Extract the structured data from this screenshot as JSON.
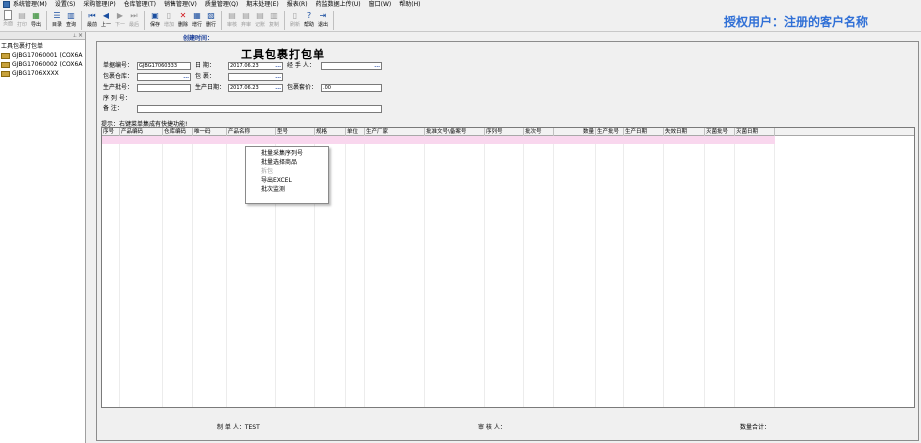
{
  "menu": {
    "items": [
      "系统管理(M)",
      "设置(S)",
      "采购管理(P)",
      "仓库管理(T)",
      "销售管理(V)",
      "质量管理(Q)",
      "期末处理(E)",
      "报表(R)",
      "药监数据上传(U)",
      "窗口(W)",
      "帮助(H)"
    ]
  },
  "toolbar": {
    "buttons": [
      {
        "label": "页面",
        "icon": "page-icon",
        "enabled": false
      },
      {
        "label": "打印",
        "icon": "print-icon",
        "enabled": false
      },
      {
        "label": "导出",
        "icon": "excel-export-icon",
        "enabled": true
      },
      {
        "label": "目录",
        "icon": "catalog-icon",
        "enabled": true
      },
      {
        "label": "查询",
        "icon": "query-icon",
        "enabled": true
      },
      {
        "label": "最前",
        "icon": "first-icon",
        "enabled": true
      },
      {
        "label": "上一",
        "icon": "prev-icon",
        "enabled": true
      },
      {
        "label": "下一",
        "icon": "next-icon",
        "enabled": false
      },
      {
        "label": "最后",
        "icon": "last-icon",
        "enabled": false
      },
      {
        "label": "保存",
        "icon": "save-icon",
        "enabled": true
      },
      {
        "label": "增加",
        "icon": "add-icon",
        "enabled": false
      },
      {
        "label": "删除",
        "icon": "delete-icon",
        "enabled": true
      },
      {
        "label": "增行",
        "icon": "add-row-icon",
        "enabled": true
      },
      {
        "label": "删行",
        "icon": "delete-row-icon",
        "enabled": true
      },
      {
        "label": "审核",
        "icon": "audit-icon",
        "enabled": false
      },
      {
        "label": "弃审",
        "icon": "unaudit-icon",
        "enabled": false
      },
      {
        "label": "记账",
        "icon": "post-icon",
        "enabled": false
      },
      {
        "label": "复制",
        "icon": "copy-icon",
        "enabled": false
      },
      {
        "label": "刷新",
        "icon": "refresh-icon",
        "enabled": false
      },
      {
        "label": "帮助",
        "icon": "help-icon",
        "enabled": true
      },
      {
        "label": "退出",
        "icon": "exit-icon",
        "enabled": true
      }
    ],
    "authorized_text": "授权用户：注册的客户名称"
  },
  "sidebar": {
    "root": "工具包裹打包单",
    "nodes": [
      "GJBG17060001 (COX6A",
      "GJBG17060002 (COX6A",
      "GJBG1706XXXX"
    ]
  },
  "form": {
    "created_label": "创建时间：",
    "title": "工具包裹打包单",
    "doc_no_label": "单据编号：",
    "doc_no_value": "GJBG17060333",
    "date_label": "日    期：",
    "date_value": "2017.06.23",
    "handler_label": "经 手 人：",
    "handler_value": "",
    "warehouse_label": "包裹仓库：",
    "warehouse_value": "",
    "package_label": "包    裹：",
    "package_value": "",
    "batch_label": "生产批号：",
    "batch_value": "",
    "prod_date_label": "生产日期：",
    "prod_date_value": "2017.06.23",
    "price_label": "包裹套价：",
    "price_value": ".00",
    "serial_label": "序 列 号：",
    "remark_label": "备    注：",
    "remark_value": "",
    "hint": "提示：右键菜单集成有快捷功能!"
  },
  "grid": {
    "columns": [
      "序号",
      "产品编码",
      "仓库编码",
      "唯一码",
      "产品名称",
      "型号",
      "规格",
      "单位",
      "生产厂家",
      "批准文号\\备案号",
      "序列号",
      "批次号",
      "数量",
      "生产批号",
      "生产日期",
      "失效日期",
      "灭菌批号",
      "灭菌日期"
    ]
  },
  "context_menu": {
    "items": [
      {
        "label": "批量采集序列号",
        "enabled": true
      },
      {
        "label": "批量选择商品",
        "enabled": true
      },
      {
        "label": "拆包",
        "enabled": false
      },
      {
        "label": "导出EXCEL",
        "enabled": true
      },
      {
        "label": "批次监测",
        "enabled": true
      }
    ]
  },
  "footer": {
    "maker_label": "制 单 人：TEST",
    "auditor_label": "审 核 人：",
    "qty_total_label": "数量合计："
  },
  "colors": {
    "authorized_text": "#2f6fd6",
    "selected_row": "#f9d7ee",
    "created_label": "#1b3f9a"
  }
}
